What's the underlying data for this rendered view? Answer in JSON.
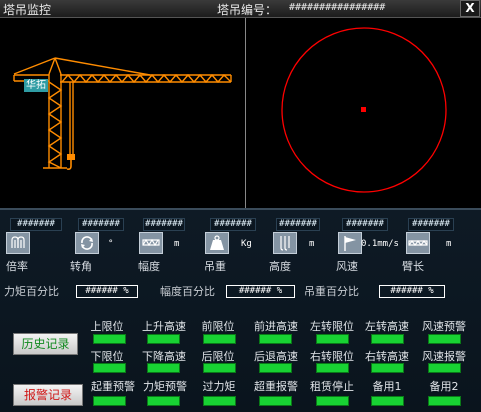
{
  "window": {
    "title": "塔吊监控",
    "crane_no_label": "塔吊编号：",
    "crane_no_value": "################",
    "close_symbol": "X"
  },
  "crane_view": {
    "brand_tag": "华拓"
  },
  "readouts": [
    {
      "key": "ratio",
      "value": "#######",
      "label": "倍率",
      "icon": "multiplier-icon",
      "unit": ""
    },
    {
      "key": "slew",
      "value": "#######",
      "label": "转角",
      "icon": "rotation-icon",
      "unit": "°"
    },
    {
      "key": "range",
      "value": "#######",
      "label": "幅度",
      "icon": "trolley-icon",
      "unit": "m"
    },
    {
      "key": "load",
      "value": "#######",
      "label": "吊重",
      "icon": "weight-icon",
      "unit": "Kg"
    },
    {
      "key": "height",
      "value": "#######",
      "label": "高度",
      "icon": "hook-height-icon",
      "unit": "m"
    },
    {
      "key": "wind",
      "value": "#######",
      "label": "风速",
      "icon": "wind-flag-icon",
      "unit": "0.1mm/s"
    },
    {
      "key": "arm",
      "value": "#######",
      "label": "臂长",
      "icon": "boom-icon",
      "unit": "m"
    }
  ],
  "percentages": [
    {
      "label": "力矩百分比",
      "value": "###### %"
    },
    {
      "label": "幅度百分比",
      "value": "###### %"
    },
    {
      "label": "吊重百分比",
      "value": "###### %"
    }
  ],
  "buttons": {
    "history": "历史记录",
    "alarm": "报警记录"
  },
  "status_rows": [
    [
      "上限位",
      "上升高速",
      "前限位",
      "前进高速",
      "左转限位",
      "左转高速",
      "风速预警"
    ],
    [
      "下限位",
      "下降高速",
      "后限位",
      "后退高速",
      "右转限位",
      "右转高速",
      "风速报警"
    ],
    [
      "起重预警",
      "力矩预警",
      "过力矩",
      "超重报警",
      "租赁停止",
      "备用1",
      "备用2"
    ]
  ],
  "colors": {
    "led_on": "#18d233",
    "crane": "#ff8c00",
    "range_circle": "#ff0000",
    "history_text": "#128a20",
    "alarm_text": "#d01818"
  }
}
